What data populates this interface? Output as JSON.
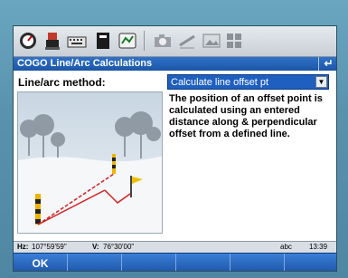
{
  "window": {
    "title": "COGO Line/Arc Calculations",
    "back_icon": "back-arrow-icon"
  },
  "form": {
    "method_label": "Line/arc method:",
    "method_value": "Calculate line offset pt",
    "description": "The position of an offset point is calculated using an entered distance along & perpendicular offset from a defined line."
  },
  "toolbar": {
    "icons": [
      "gauge-icon",
      "robot-icon",
      "keyboard-icon",
      "book-icon",
      "survey-icon",
      "camera-icon",
      "measure-icon",
      "image-icon",
      "grid-icon"
    ]
  },
  "status": {
    "hz_label": "Hz:",
    "hz_value": "107°59'59\"",
    "v_label": "V:",
    "v_value": "76°30'00\"",
    "input_mode": "abc",
    "time": "13:39"
  },
  "softkeys": {
    "ok": "OK"
  },
  "colors": {
    "title_bar": "#1d55a8",
    "dropdown": "#1f5fbf",
    "softbar": "#1e56aa",
    "bezel": "#5a92ad"
  }
}
